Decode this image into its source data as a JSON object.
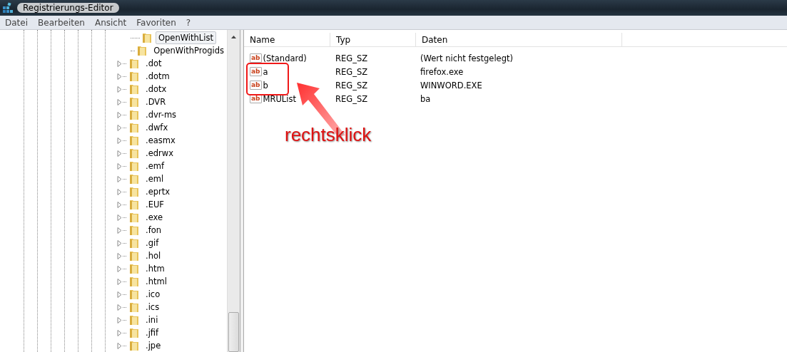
{
  "window": {
    "title": "Registrierungs-Editor"
  },
  "menu": [
    "Datei",
    "Bearbeiten",
    "Ansicht",
    "Favoriten",
    "?"
  ],
  "tree": [
    {
      "label": "OpenWithList",
      "kind": "leaf",
      "selected": true
    },
    {
      "label": "OpenWithProgids",
      "kind": "leaf",
      "selected": false
    },
    {
      "label": ".dot",
      "kind": "node",
      "selected": false
    },
    {
      "label": ".dotm",
      "kind": "node",
      "selected": false
    },
    {
      "label": ".dotx",
      "kind": "node",
      "selected": false
    },
    {
      "label": ".DVR",
      "kind": "node",
      "selected": false
    },
    {
      "label": ".dvr-ms",
      "kind": "node",
      "selected": false
    },
    {
      "label": ".dwfx",
      "kind": "node",
      "selected": false
    },
    {
      "label": ".easmx",
      "kind": "node",
      "selected": false
    },
    {
      "label": ".edrwx",
      "kind": "node",
      "selected": false
    },
    {
      "label": ".emf",
      "kind": "node",
      "selected": false
    },
    {
      "label": ".eml",
      "kind": "node",
      "selected": false
    },
    {
      "label": ".eprtx",
      "kind": "node",
      "selected": false
    },
    {
      "label": ".EUF",
      "kind": "node",
      "selected": false
    },
    {
      "label": ".exe",
      "kind": "node",
      "selected": false
    },
    {
      "label": ".fon",
      "kind": "node",
      "selected": false
    },
    {
      "label": ".gif",
      "kind": "node",
      "selected": false
    },
    {
      "label": ".hol",
      "kind": "node",
      "selected": false
    },
    {
      "label": ".htm",
      "kind": "node",
      "selected": false
    },
    {
      "label": ".html",
      "kind": "node",
      "selected": false
    },
    {
      "label": ".ico",
      "kind": "node",
      "selected": false
    },
    {
      "label": ".ics",
      "kind": "node",
      "selected": false
    },
    {
      "label": ".ini",
      "kind": "node",
      "selected": false
    },
    {
      "label": ".jfif",
      "kind": "node",
      "selected": false
    },
    {
      "label": ".jpe",
      "kind": "node",
      "selected": false
    }
  ],
  "table": {
    "columns": [
      "Name",
      "Typ",
      "Daten"
    ],
    "rows": [
      {
        "icon": "ab",
        "name": "(Standard)",
        "type": "REG_SZ",
        "data": "(Wert nicht festgelegt)",
        "highlighted": false
      },
      {
        "icon": "ab",
        "name": "a",
        "type": "REG_SZ",
        "data": "firefox.exe",
        "highlighted": true
      },
      {
        "icon": "ab",
        "name": "b",
        "type": "REG_SZ",
        "data": "WINWORD.EXE",
        "highlighted": true
      },
      {
        "icon": "ab",
        "name": "MRUList",
        "type": "REG_SZ",
        "data": "ba",
        "highlighted": false
      }
    ]
  },
  "annotation": {
    "label": "rechtsklick"
  }
}
